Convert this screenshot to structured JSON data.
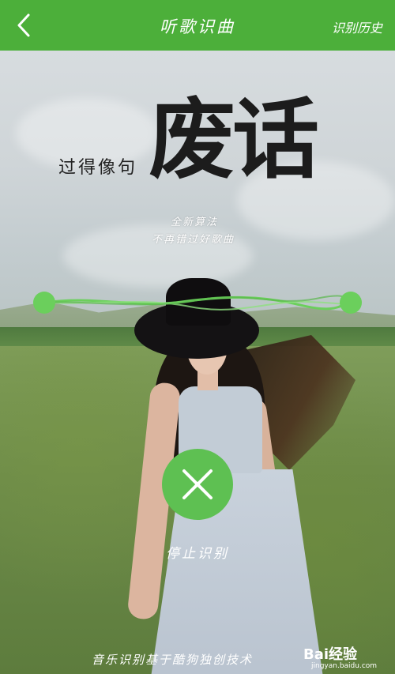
{
  "header": {
    "title": "听歌识曲",
    "history_label": "识别历史",
    "back_icon": "chevron-left-icon",
    "bg": "#4caf3a"
  },
  "poster": {
    "headline": "过得像句",
    "big_word": "废话",
    "sub_line1": "全新算法",
    "sub_line2": "不再错过好歌曲"
  },
  "listening": {
    "wave_color": "#6bcf5c",
    "stop_icon": "close-icon",
    "stop_label": "停止识别"
  },
  "footer": {
    "text": "音乐识别基于酷狗独创技术"
  },
  "watermark": {
    "brand": "Bai经验",
    "url": "jingyan.baidu.com"
  }
}
